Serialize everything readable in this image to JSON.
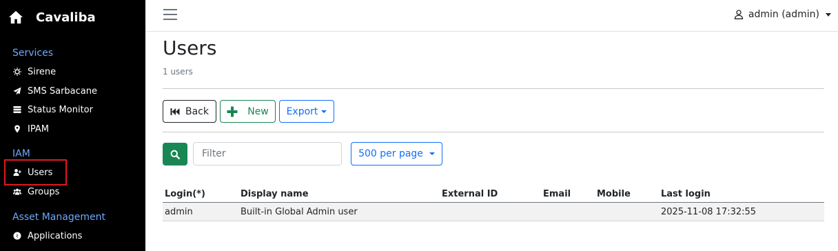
{
  "brand": {
    "name": "Cavaliba"
  },
  "sidebar": {
    "sections": [
      {
        "title": "Services",
        "items": [
          {
            "label": "Sirene",
            "icon": "sun-icon"
          },
          {
            "label": "SMS Sarbacane",
            "icon": "paper-plane-icon"
          },
          {
            "label": "Status Monitor",
            "icon": "server-icon"
          },
          {
            "label": "IPAM",
            "icon": "map-pin-icon"
          }
        ]
      },
      {
        "title": "IAM",
        "items": [
          {
            "label": "Users",
            "icon": "user-plus-icon"
          },
          {
            "label": "Groups",
            "icon": "users-icon"
          }
        ]
      },
      {
        "title": "Asset Management",
        "items": [
          {
            "label": "Applications",
            "icon": "app-icon"
          }
        ]
      }
    ]
  },
  "topbar": {
    "user": "admin (admin)"
  },
  "page": {
    "title": "Users",
    "count": "1 users"
  },
  "toolbar": {
    "back": "Back",
    "new": "New",
    "export": "Export"
  },
  "filter": {
    "placeholder": "Filter",
    "per_page": "500 per page"
  },
  "table": {
    "headers": [
      "Login(*)",
      "Display name",
      "External ID",
      "Email",
      "Mobile",
      "Last login"
    ],
    "rows": [
      [
        "admin",
        "Built-in Global Admin user",
        "",
        "",
        "",
        "2025-11-08 17:32:55"
      ]
    ]
  },
  "colors": {
    "sidebar_bg": "#000000",
    "section": "#6ea8fe",
    "success": "#198754",
    "primary": "#0d6efd",
    "highlight": "#e0191f"
  }
}
